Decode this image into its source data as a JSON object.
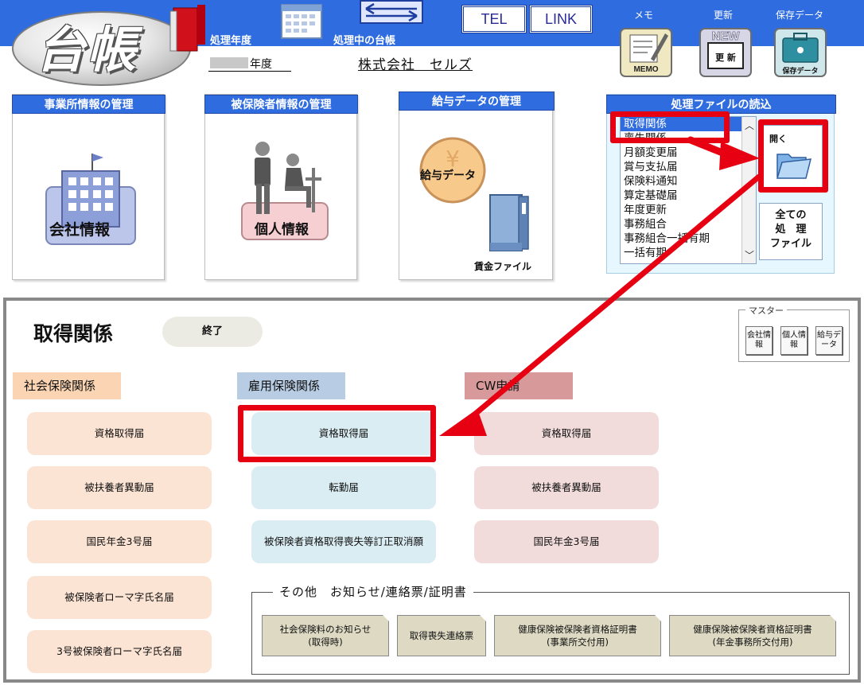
{
  "header": {
    "logo_text": "台帳",
    "fiscal_year_label": "処理年度",
    "ledger_label": "処理中の台帳",
    "tel_label": "TEL",
    "link_label": "LINK",
    "memo_label": "メモ",
    "update_label": "更新",
    "save_label": "保存データ",
    "memo_icon_text": "MEMO",
    "update_icon_new": "NEW",
    "update_icon_text": "更 新",
    "save_icon_text": "保存データ",
    "year_suffix": "年度",
    "company_name": "株式会社　セルズ"
  },
  "panels": {
    "company": {
      "title": "事業所情報の管理",
      "button_label": "会社情報"
    },
    "person": {
      "title": "被保険者情報の管理",
      "button_label": "個人情報"
    },
    "salary": {
      "title": "給与データの管理",
      "button_label": "給与データ",
      "wage_file_label": "賃金ファイル"
    },
    "files": {
      "title": "処理ファイルの読込",
      "items": [
        "取得関係",
        "喪失関係",
        "月額変更届",
        "賞与支払届",
        "保険料通知",
        "算定基礎届",
        "年度更新",
        "事務組合",
        "事務組合一括有期",
        "一括有期"
      ],
      "open_label": "開く",
      "all_files_line1": "全ての",
      "all_files_line2": "処　理",
      "all_files_line3": "ファイル"
    }
  },
  "dialog": {
    "title": "取得関係",
    "close_label": "終了",
    "master_label": "マスター",
    "master_company": "会社情報",
    "master_person": "個人情報",
    "master_salary": "給与データ",
    "categories": {
      "social": "社会保険関係",
      "employment": "雇用保険関係",
      "cw": "CW申請"
    },
    "social_buttons": [
      "資格取得届",
      "被扶養者異動届",
      "国民年金3号届",
      "被保険者ローマ字氏名届",
      "3号被保険者ローマ字氏名届"
    ],
    "employment_buttons": [
      "資格取得届",
      "転勤届",
      "被保険者資格取得喪失等訂正取消願"
    ],
    "cw_buttons": [
      "資格取得届",
      "被扶養者異動届",
      "国民年金3号届"
    ],
    "other": {
      "label": "その他　お知らせ/連絡票/証明書",
      "notices": [
        {
          "line1": "社会保険料のお知らせ",
          "line2": "(取得時)"
        },
        {
          "line1": "取得喪失連絡票",
          "line2": ""
        },
        {
          "line1": "健康保険被保険者資格証明書",
          "line2": "(事業所交付用)"
        },
        {
          "line1": "健康保険被保険者資格証明書",
          "line2": "(年金事務所交付用)"
        }
      ]
    }
  },
  "colors": {
    "header_blue": "#2f6cdf",
    "highlight_red": "#e60012",
    "social_header": "#fbd5b3",
    "employment_header": "#b8cce4",
    "cw_header": "#d8999a"
  }
}
